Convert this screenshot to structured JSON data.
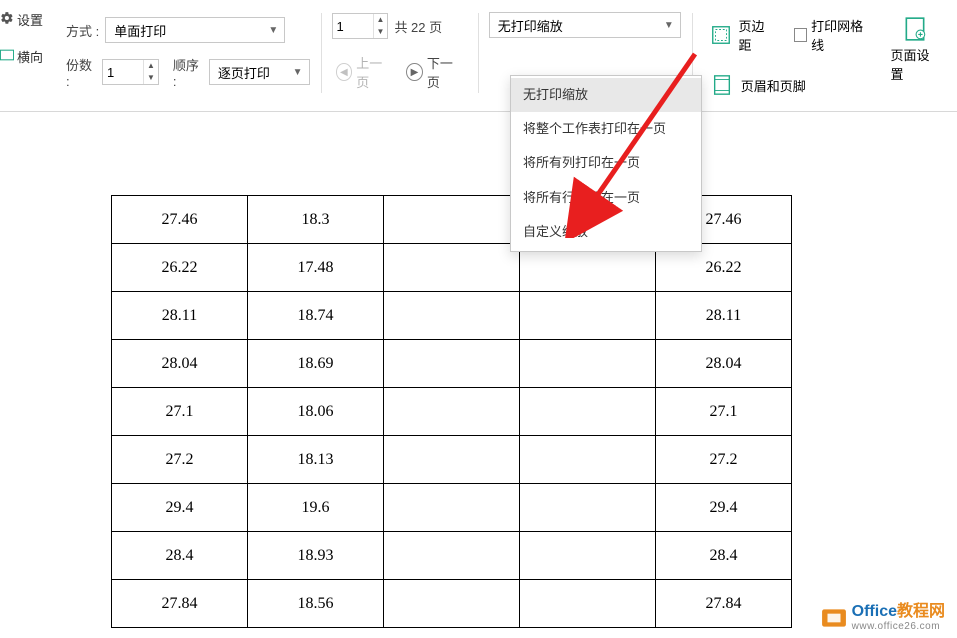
{
  "left": {
    "settings": "设置",
    "orient": "横向"
  },
  "toolbar": {
    "side_label": "方式 :",
    "side_value": "单面打印",
    "copies_label": "份数 :",
    "copies_value": "1",
    "order_label": "顺序 :",
    "order_value": "逐页打印",
    "page_value": "1",
    "total_pages": "共 22 页",
    "prev": "上一页",
    "next": "下一页",
    "zoom_value": "无打印缩放",
    "page_margin": "页边距",
    "grid_label": "打印网格线",
    "header_footer": "页眉和页脚",
    "page_setup": "页面设置"
  },
  "dropdown": {
    "items": [
      "无打印缩放",
      "将整个工作表打印在一页",
      "将所有列打印在一页",
      "将所有行打印在一页",
      "自定义缩放"
    ]
  },
  "table": {
    "rows": [
      {
        "c1": "27.46",
        "c2": "18.3",
        "c3": "",
        "c4": "",
        "c5": "27.46"
      },
      {
        "c1": "26.22",
        "c2": "17.48",
        "c3": "",
        "c4": "",
        "c5": "26.22"
      },
      {
        "c1": "28.11",
        "c2": "18.74",
        "c3": "",
        "c4": "",
        "c5": "28.11"
      },
      {
        "c1": "28.04",
        "c2": "18.69",
        "c3": "",
        "c4": "",
        "c5": "28.04"
      },
      {
        "c1": "27.1",
        "c2": "18.06",
        "c3": "",
        "c4": "",
        "c5": "27.1"
      },
      {
        "c1": "27.2",
        "c2": "18.13",
        "c3": "",
        "c4": "",
        "c5": "27.2"
      },
      {
        "c1": "29.4",
        "c2": "19.6",
        "c3": "",
        "c4": "",
        "c5": "29.4"
      },
      {
        "c1": "28.4",
        "c2": "18.93",
        "c3": "",
        "c4": "",
        "c5": "28.4"
      },
      {
        "c1": "27.84",
        "c2": "18.56",
        "c3": "",
        "c4": "",
        "c5": "27.84"
      }
    ]
  },
  "watermark": {
    "text1a": "Office",
    "text1b": "教程网",
    "url": "www.office26.com"
  }
}
